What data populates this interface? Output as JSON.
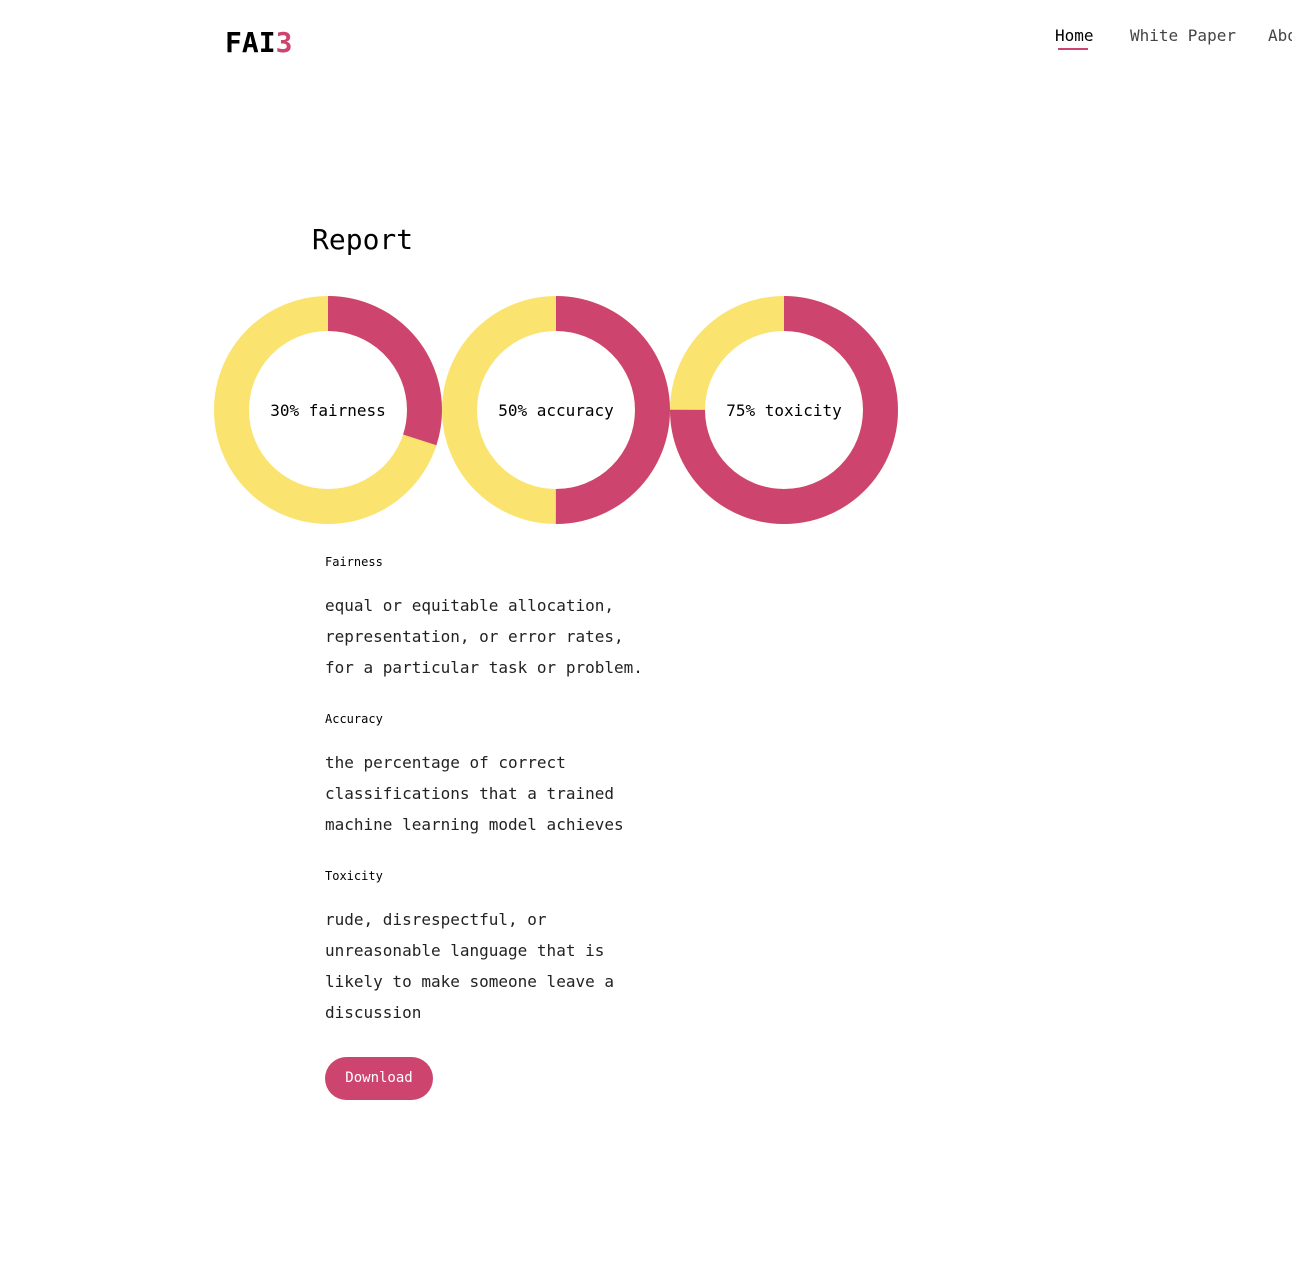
{
  "header": {
    "logo_main": "FAI",
    "logo_accent": "3",
    "nav": [
      {
        "label": "Home",
        "active": true
      },
      {
        "label": "White Paper",
        "active": false
      },
      {
        "label": "Abo",
        "active": false
      }
    ]
  },
  "report": {
    "title": "Report"
  },
  "chart_data": {
    "type": "pie",
    "colors": {
      "filled": "#cd456f",
      "remaining": "#fae46f"
    },
    "items": [
      {
        "label": "30% fairness",
        "value": 30
      },
      {
        "label": "50% accuracy",
        "value": 50
      },
      {
        "label": "75% toxicity",
        "value": 75
      }
    ]
  },
  "definitions": [
    {
      "term": "Fairness",
      "lines": [
        "equal or equitable allocation,",
        "representation, or error rates,",
        "for a particular task or problem."
      ]
    },
    {
      "term": "Accuracy",
      "lines": [
        "the percentage of correct",
        "classifications that a trained",
        "machine learning model achieves"
      ]
    },
    {
      "term": "Toxicity",
      "lines": [
        "rude, disrespectful, or",
        "unreasonable language that is",
        "likely to make someone leave a",
        "discussion"
      ]
    }
  ],
  "actions": {
    "download_label": "Download"
  }
}
